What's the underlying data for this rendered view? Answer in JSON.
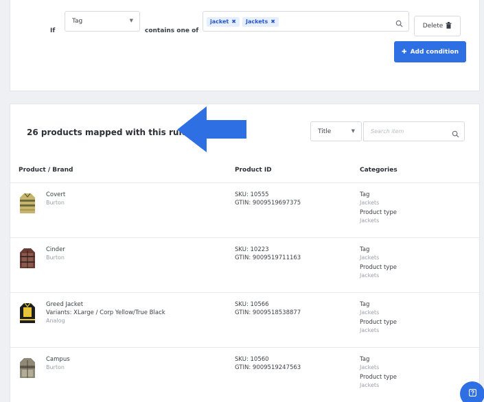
{
  "rule": {
    "if_label": "If",
    "field_select": "Tag",
    "operator": "contains one of",
    "chips": [
      "jacket",
      "Jackets"
    ],
    "delete_label": "Delete",
    "add_condition_label": "Add condition"
  },
  "products_section": {
    "mapped_title": "26 products mapped with this rule",
    "sort_select": "Title",
    "search_placeholder": "Search item",
    "columns": [
      "Product / Brand",
      "Product ID",
      "Categories"
    ]
  },
  "products": [
    {
      "name": "Covert",
      "brand": "Burton",
      "sku": "SKU: 10555",
      "gtin": "GTIN: 9009519697375",
      "categories": [
        {
          "label": "Tag",
          "value": "Jackets"
        },
        {
          "label": "Product type",
          "value": "Jackets"
        }
      ]
    },
    {
      "name": "Cinder",
      "brand": "Burton",
      "sku": "SKU: 10223",
      "gtin": "GTIN: 9009519711163",
      "categories": [
        {
          "label": "Tag",
          "value": "Jackets"
        },
        {
          "label": "Product type",
          "value": "Jackets"
        }
      ]
    },
    {
      "name": "Greed Jacket",
      "variant": "Variants: XLarge / Corp Yellow/True Black",
      "brand": "Analog",
      "sku": "SKU: 10566",
      "gtin": "GTIN: 9009518538877",
      "categories": [
        {
          "label": "Tag",
          "value": "Jackets"
        },
        {
          "label": "Product type",
          "value": "Jackets"
        }
      ]
    },
    {
      "name": "Campus",
      "brand": "Burton",
      "sku": "SKU: 10560",
      "gtin": "GTIN: 9009519247563",
      "categories": [
        {
          "label": "Tag",
          "value": "Jackets"
        },
        {
          "label": "Product type",
          "value": "Jackets"
        }
      ]
    }
  ],
  "icons": {
    "search": "search-icon",
    "trash": "trash-icon",
    "plus": "plus-icon",
    "chevron": "chevron-down-icon",
    "remove_chip": "close-icon",
    "help": "help-icon",
    "arrow": "arrow-left-icon"
  },
  "colors": {
    "accent": "#2f6fe4",
    "chip_bg": "#e6efff",
    "chip_text": "#2656c9"
  }
}
